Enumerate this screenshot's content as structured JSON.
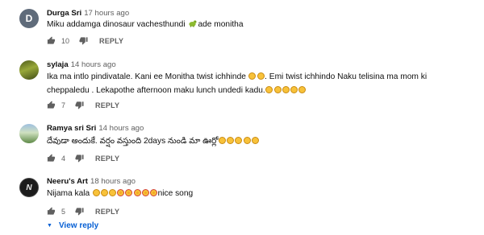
{
  "comments": [
    {
      "avatar_letter": "D",
      "author": "Durga Sri",
      "time": "17 hours ago",
      "text_before": "Miku addamga dinosaur vachesthundi ",
      "text_after": "ade monitha",
      "likes": "10",
      "reply_label": "REPLY"
    },
    {
      "author": "sylaja",
      "time": "14 hours ago",
      "text_a": "Ika ma intlo pindivatale. Kani ee Monitha twist ichhinde ",
      "text_b": ". Emi twist ichhindo Naku telisina ma mom ki cheppaledu . Lekapothe afternoon maku lunch undedi kadu.",
      "likes": "7",
      "reply_label": "REPLY"
    },
    {
      "author": "Ramya sri Sri",
      "time": "14 hours ago",
      "text": "దేవుడా అందుకే. వర్షం వస్తుంది 2days నుండి మా ఊర్లో",
      "likes": "4",
      "reply_label": "REPLY"
    },
    {
      "avatar_mark": "N",
      "author": "Neeru's Art",
      "time": "18 hours ago",
      "text_before": "Nijama kala ",
      "text_after": "nice song",
      "likes": "5",
      "reply_label": "REPLY"
    }
  ],
  "view_replies": "View reply",
  "icons": [
    "thumbs-up-icon",
    "thumbs-down-icon",
    "caret-down-icon",
    "dinosaur-emoji-icon",
    "smiley-emoji-icon",
    "heart-eyes-emoji-icon"
  ]
}
